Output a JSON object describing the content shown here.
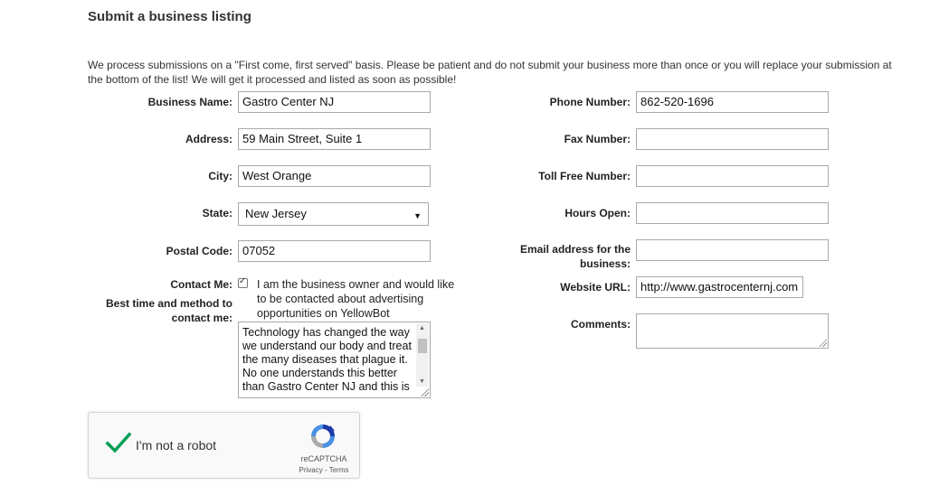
{
  "page": {
    "title": "Submit a business listing",
    "intro": "We process submissions on a \"First come, first served\" basis. Please be patient and do not submit your business more than once or you will replace your submission at the bottom of the list! We will get it processed and listed as soon as possible!"
  },
  "form": {
    "business_name": {
      "label": "Business Name:",
      "value": "Gastro Center NJ"
    },
    "address": {
      "label": "Address:",
      "value": "59 Main Street, Suite 1"
    },
    "city": {
      "label": "City:",
      "value": "West Orange"
    },
    "state": {
      "label": "State:",
      "value": "New Jersey"
    },
    "postal_code": {
      "label": "Postal Code:",
      "value": "07052"
    },
    "contact_me": {
      "label": "Contact Me:",
      "checked": true,
      "text": "I am the business owner and would like to be contacted about advertising opportunities on YellowBot"
    },
    "best_time": {
      "label_line1": "Best time and method to",
      "label_line2": "contact me:",
      "value": "Technology has changed the way we understand our body and treat the many diseases that plague it. No one understands this better than Gastro Center NJ and this is"
    },
    "phone": {
      "label": "Phone Number:",
      "value": "862-520-1696"
    },
    "fax": {
      "label": "Fax Number:",
      "value": ""
    },
    "toll_free": {
      "label": "Toll Free Number:",
      "value": ""
    },
    "hours_open": {
      "label": "Hours Open:",
      "value": ""
    },
    "email": {
      "label_line1": "Email address for the",
      "label_line2": "business:",
      "value": ""
    },
    "website": {
      "label": "Website URL:",
      "value": "http://www.gastrocenternj.com"
    },
    "comments": {
      "label": "Comments:",
      "value": ""
    }
  },
  "captcha": {
    "label": "I'm not a robot",
    "brand": "reCAPTCHA",
    "terms": "Privacy - Terms",
    "checked": true,
    "check_color": "#009e55"
  }
}
